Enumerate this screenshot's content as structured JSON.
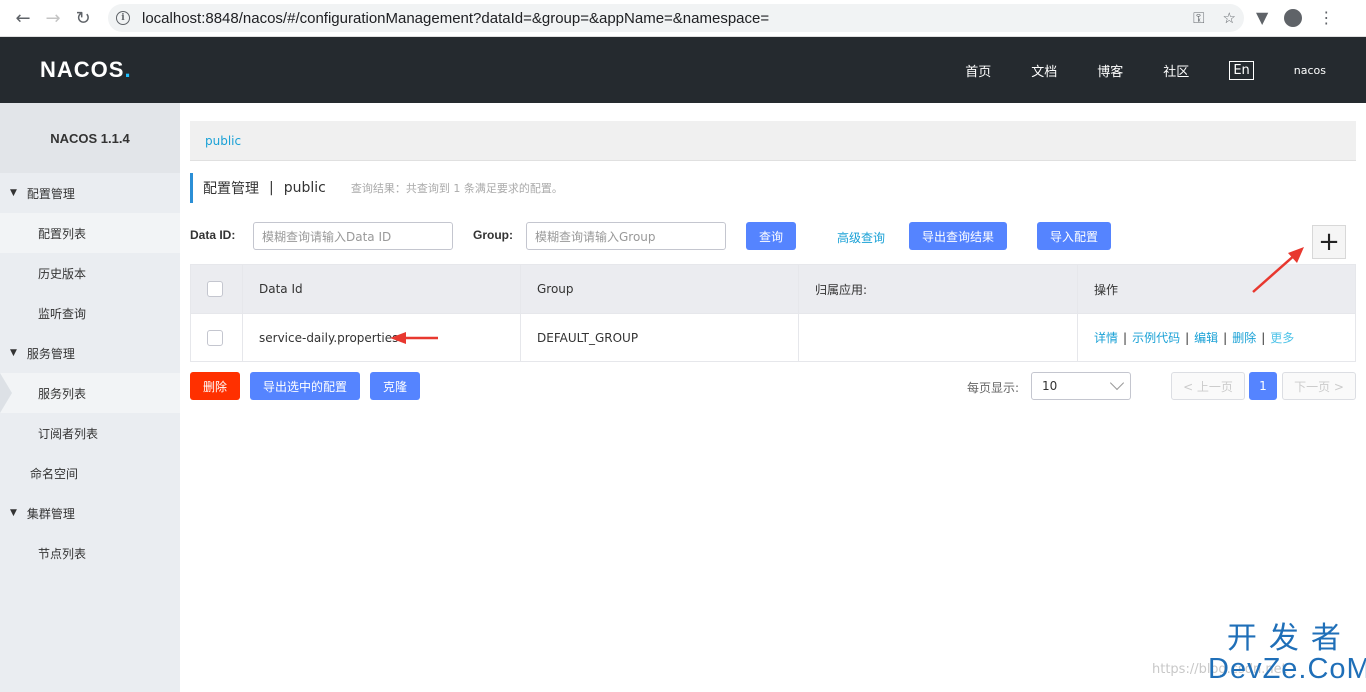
{
  "browser": {
    "url": "localhost:8848/nacos/#/configurationManagement?dataId=&group=&appName=&namespace="
  },
  "header": {
    "logo": "NACOS",
    "logo_dot": ".",
    "nav": [
      "首页",
      "文档",
      "博客",
      "社区"
    ],
    "lang": "En",
    "user": "nacos"
  },
  "sidebar": {
    "title": "NACOS 1.1.4",
    "groups": [
      {
        "label": "配置管理",
        "items": [
          "配置列表",
          "历史版本",
          "监听查询"
        ]
      },
      {
        "label": "服务管理",
        "items": [
          "服务列表",
          "订阅者列表"
        ]
      },
      {
        "label": "命名空间"
      },
      {
        "label": "集群管理",
        "items": [
          "节点列表"
        ]
      }
    ]
  },
  "main": {
    "breadcrumb": "public",
    "title": "配置管理",
    "title_sep": "|",
    "namespace": "public",
    "result_text": "查询结果：共查询到 1 条满足要求的配置。",
    "filters": {
      "dataid_label": "Data ID:",
      "dataid_placeholder": "模糊查询请输入Data ID",
      "group_label": "Group:",
      "group_placeholder": "模糊查询请输入Group",
      "query_btn": "查询",
      "advanced_link": "高级查询",
      "export_btn": "导出查询结果",
      "import_btn": "导入配置",
      "add_btn": "+"
    },
    "table": {
      "headers": [
        "Data Id",
        "Group",
        "归属应用:",
        "操作"
      ],
      "rows": [
        {
          "data_id": "service-daily.properties",
          "group": "DEFAULT_GROUP",
          "app": "",
          "ops": [
            "详情",
            "示例代码",
            "编辑",
            "删除",
            "更多"
          ]
        }
      ]
    },
    "bottom": {
      "delete_btn": "删除",
      "export_selected_btn": "导出选中的配置",
      "clone_btn": "克隆",
      "pagesize_label": "每页显示:",
      "pagesize_value": "10",
      "prev": "< 上一页",
      "page": "1",
      "next": "下一页 >"
    }
  },
  "overlay": {
    "watermark": "https://blog.csdn.net",
    "brand_cn": "开发者",
    "brand_en": "DevZe.CoM"
  }
}
